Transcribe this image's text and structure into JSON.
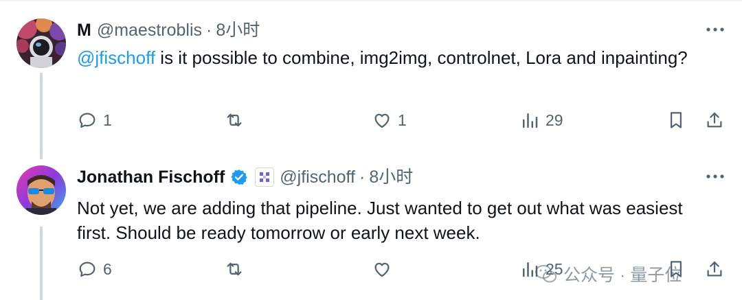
{
  "reply1": {
    "name": "M",
    "handle": "@maestroblis",
    "separator": "·",
    "time": "8小时",
    "mention": "@jfischoff",
    "text": " is it possible to combine, img2img, controlnet, Lora and inpainting?",
    "actions": {
      "replies": "1",
      "reposts": "",
      "likes": "1",
      "views": "29"
    }
  },
  "reply2": {
    "name": "Jonathan Fischoff",
    "handle": "@jfischoff",
    "separator": "·",
    "time": "8小时",
    "text": "Not yet, we are adding that pipeline. Just wanted to get out what was easiest first. Should be ready tomorrow or early next week.",
    "actions": {
      "replies": "6",
      "reposts": "",
      "likes": "",
      "views": "25"
    }
  },
  "watermark": {
    "text": "公众号 · 量子位"
  },
  "colors": {
    "accent": "#1d9bf0",
    "muted": "#536471",
    "text": "#0f1419",
    "verified": "#1d9bf0"
  },
  "icons": [
    "reply-icon",
    "repost-icon",
    "like-icon",
    "views-icon",
    "bookmark-icon",
    "share-icon",
    "more-icon",
    "verified-badge-icon",
    "affiliation-icon"
  ]
}
